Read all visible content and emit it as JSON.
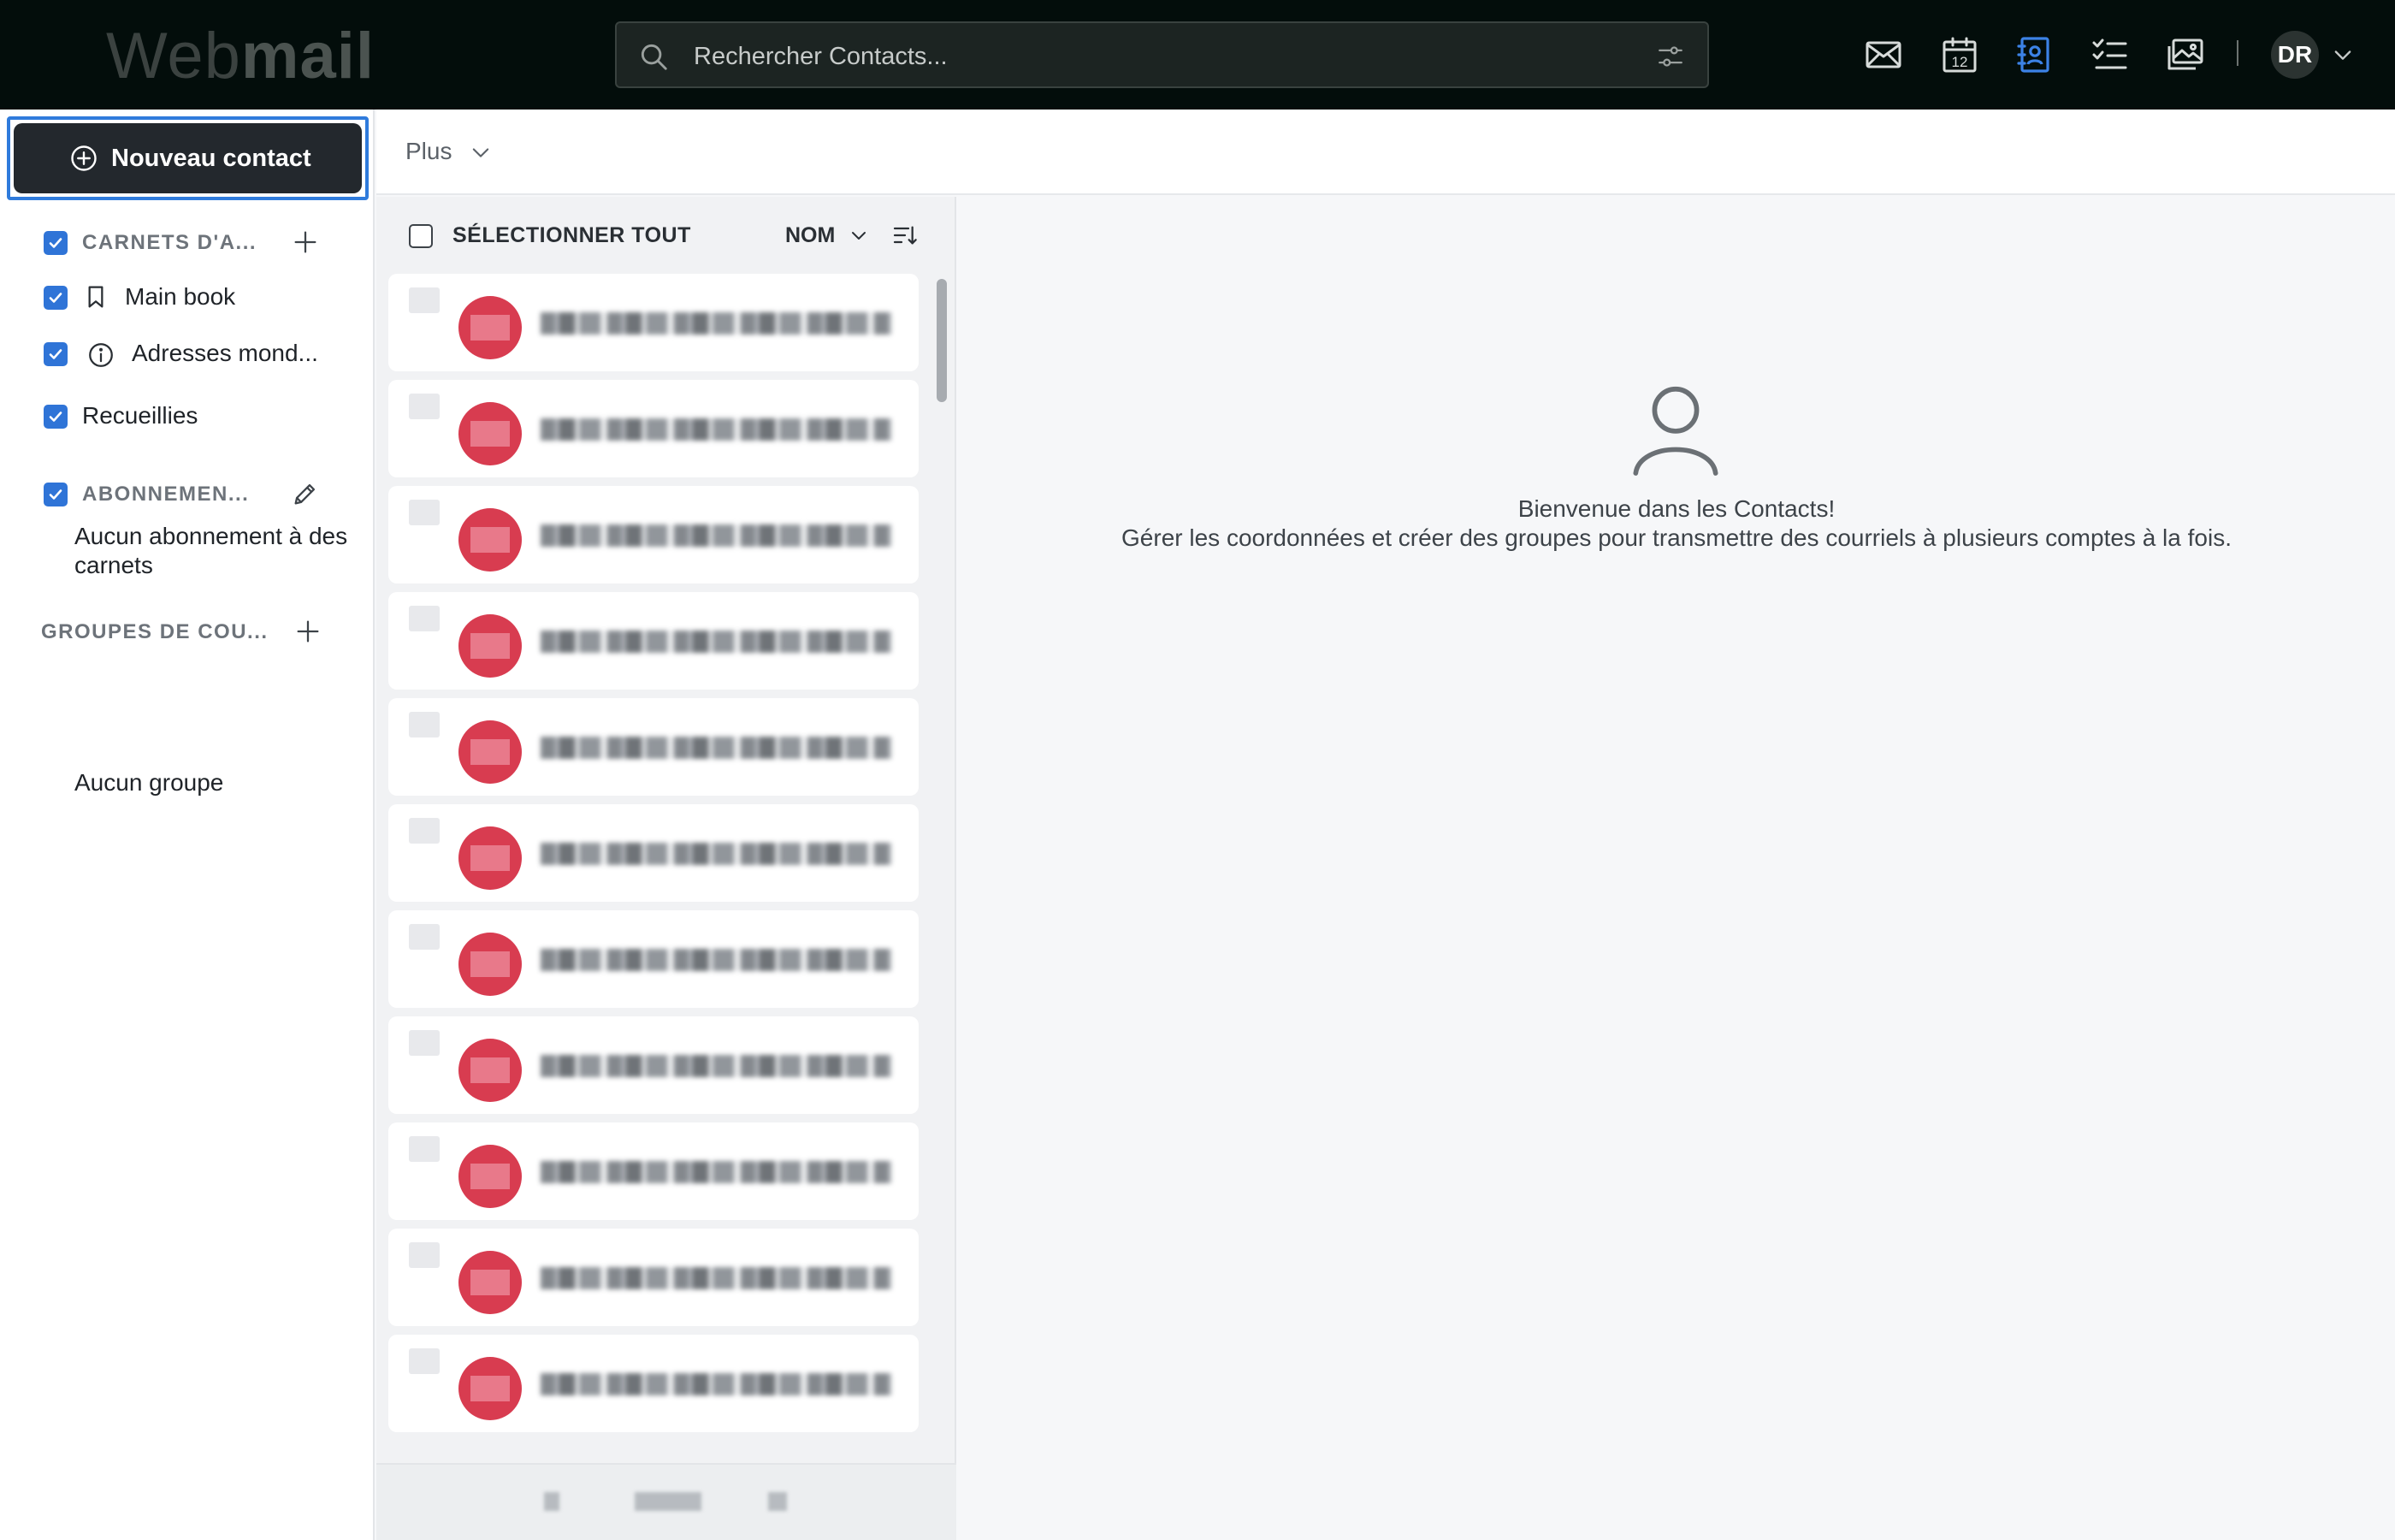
{
  "app": {
    "logo_part1": "Web",
    "logo_part2": "mail"
  },
  "search": {
    "placeholder": "Rechercher Contacts..."
  },
  "topbar": {
    "icons": [
      "mail-icon",
      "calendar-icon",
      "contacts-icon",
      "tasks-icon",
      "photos-icon"
    ],
    "calendar_day": "12",
    "user_initials": "DR",
    "active_icon_color": "#3c82e6"
  },
  "sidebar": {
    "new_contact_label": "Nouveau contact",
    "address_books_header": "CARNETS D'A...",
    "books": [
      {
        "label": "Main book",
        "checked": true
      },
      {
        "label": "Adresses mond...",
        "checked": true
      },
      {
        "label": "Recueillies",
        "checked": true
      }
    ],
    "subscriptions_header": "ABONNEMEN...",
    "subscriptions_empty": "Aucun abonnement à des carnets",
    "groups_header": "GROUPES DE COU...",
    "groups_empty": "Aucun groupe"
  },
  "toolbar": {
    "more_label": "Plus"
  },
  "list": {
    "select_all_label": "SÉLECTIONNER TOUT",
    "sort_label": "NOM",
    "contacts": [
      "",
      "",
      "",
      "",
      "",
      "",
      "",
      "",
      "",
      "",
      ""
    ]
  },
  "main": {
    "welcome_title": "Bienvenue dans les Contacts!",
    "welcome_text": "Gérer les coordonnées et créer des groupes pour transmettre des courriels à plusieurs comptes à la fois."
  },
  "colors": {
    "topbar_bg": "#030d0b",
    "primary_button": "#23282d",
    "checkbox_blue": "#2f74d7",
    "focus_outline": "#2f7bdc",
    "avatar_red": "#d83c50"
  }
}
